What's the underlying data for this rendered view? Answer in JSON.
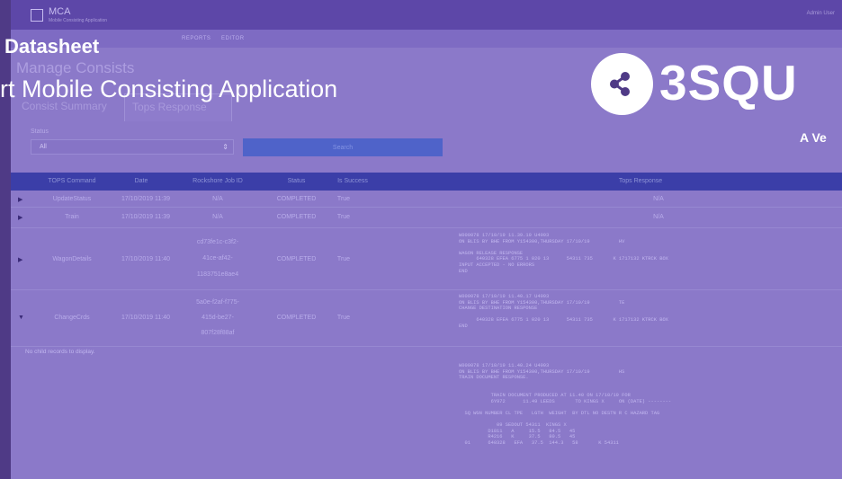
{
  "overlay": {
    "title": "Datasheet",
    "subtitle": "rt Mobile Consisting Application",
    "logo_text": "3SQU",
    "tagline": "A Ve",
    "logo_icon": "share-icon"
  },
  "app": {
    "name": "MCA",
    "subtitle": "Mobile Consisting Application",
    "user": "Admin User",
    "nav": [
      "REPORTS",
      "EDITOR"
    ]
  },
  "page": {
    "title": "Manage Consists",
    "tabs": [
      "Consist Summary",
      "Tops Response"
    ]
  },
  "filter": {
    "label": "Status",
    "value": "All",
    "search_label": "Search"
  },
  "grid": {
    "columns": [
      "TOPS Command",
      "Date",
      "Rockshore Job ID",
      "Status",
      "Is Success",
      "Tops Response"
    ],
    "rows": [
      {
        "command": "UpdateStatus",
        "date": "17/10/2019 11:39",
        "job_id": "N/A",
        "job_id_lines": [
          "N/A"
        ],
        "status": "COMPLETED",
        "success": "True",
        "response": "N/A"
      },
      {
        "command": "Train",
        "date": "17/10/2019 11:39",
        "job_id": "N/A",
        "job_id_lines": [
          "N/A"
        ],
        "status": "COMPLETED",
        "success": "True",
        "response": "N/A"
      },
      {
        "command": "WagonDetails",
        "date": "17/10/2019 11:40",
        "job_id_lines": [
          "cd73fe1c-c3f2-",
          "41ce-af42-",
          "1183751e8ae4"
        ],
        "status": "COMPLETED",
        "success": "True",
        "response_lines": [
          "W000078 17/10/19 11.39.19 U4993",
          "ON BLIS BY BHE FROM Y154300,THURSDAY 17/10/19          HV",
          "",
          "WAGON RELEASE RESPONSE",
          "      640328 EFEA 6775 1 020 13      54311 735       K 1717132 KTRCK BOX",
          "INPUT ACCEPTED - NO ERRORS",
          "END"
        ]
      },
      {
        "command": "ChangeCrds",
        "date": "17/10/2019 11:40",
        "job_id_lines": [
          "5a0e-f2af-f775-",
          "415d-be27-",
          "807f28f88af"
        ],
        "status": "COMPLETED",
        "success": "True",
        "response_lines": [
          "W000078 17/10/19 11.40.17 U4993",
          "ON BLIS BY BHE FROM Y154300,THURSDAY 17/10/19          TE",
          "CHANGE DESTINATION RESPONSE",
          "",
          "      640328 EFEA 6775 1 020 13      54311 735       K 1717132 KTRCK BOX",
          "END"
        ]
      }
    ],
    "no_child": "No child records to display.",
    "detail_lines": [
      "W000078 17/10/19 11.40.24 U4993",
      "ON BLIS BY BHE FROM Y154300,THURSDAY 17/10/19          HS",
      "TRAIN DOCUMENT RESPONSE.",
      "",
      "",
      "           TRAIN DOCUMENT PRODUCED AT 11.40 ON 17/10/19 FOR",
      "           6Y972      11.49 LEEDS       TO KINGS X     ON (DATE) --------",
      "",
      "  SQ WGN NUMBER CL TPE   LGTH  WEIGHT  BY DTL NO DESTN R C HAZARD TAG",
      "",
      "             09 SEDOUT 54311  KINGS X",
      "          D1811   A     15.5   84.5   45",
      "          R4216   K     37.5   80.5   45",
      "  01      640328   EFA   37.5  144.3   58       K 54311"
    ]
  }
}
